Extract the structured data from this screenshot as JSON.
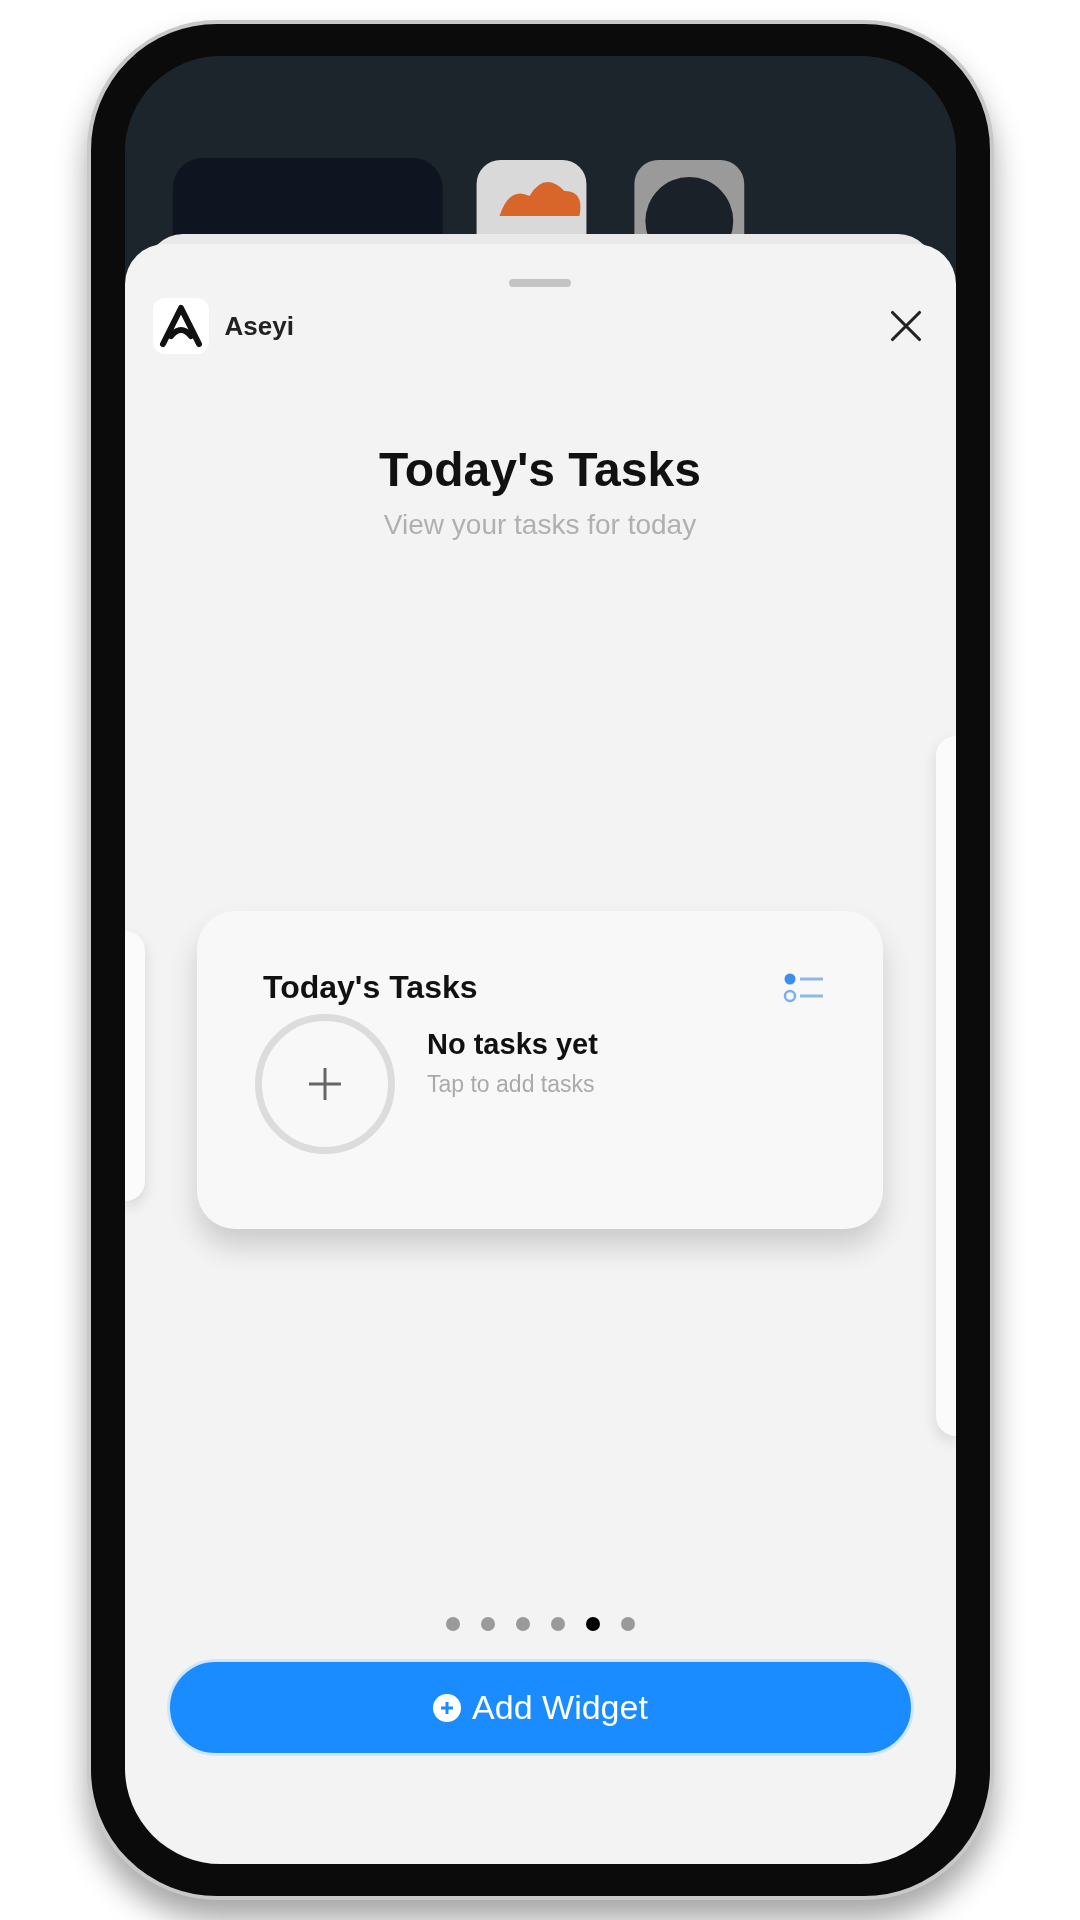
{
  "app": {
    "name": "Aseyi"
  },
  "title": "Today's Tasks",
  "subtitle": "View your tasks for today",
  "widget": {
    "title": "Today's Tasks",
    "empty_title": "No tasks yet",
    "empty_hint": "Tap to add tasks"
  },
  "pages": [
    {
      "selected": false
    },
    {
      "selected": false
    },
    {
      "selected": false
    },
    {
      "selected": false
    },
    {
      "selected": true
    },
    {
      "selected": false
    }
  ],
  "add_button": {
    "label": "Add Widget"
  }
}
